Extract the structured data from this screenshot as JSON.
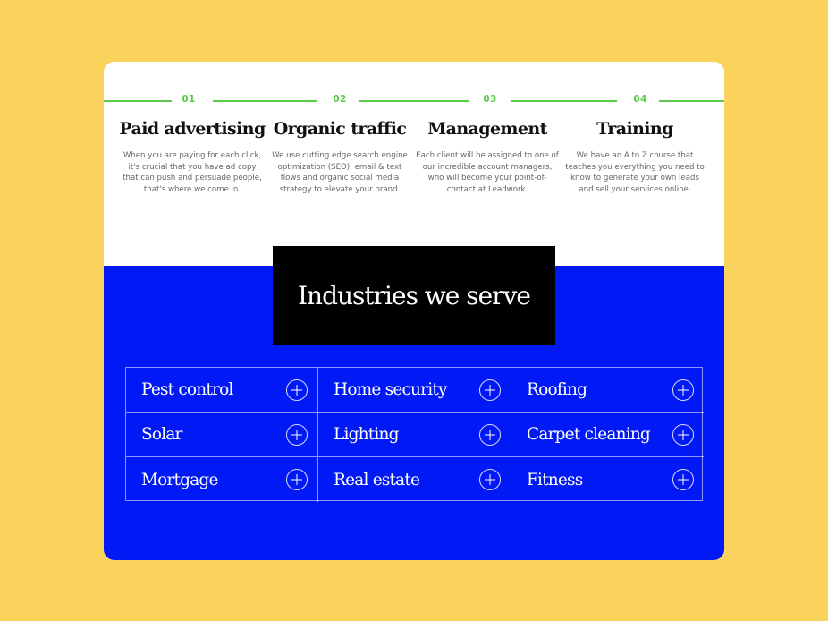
{
  "colors": {
    "background": "#f9d35b",
    "accent_green": "#5bc94a",
    "brand_blue": "#0019f5",
    "heading_box": "#000000"
  },
  "steps": [
    {
      "number": "01",
      "title": "Paid advertising",
      "description": "When you are paying for each click, it's crucial that you have ad copy that can push and persuade people, that's where we come in."
    },
    {
      "number": "02",
      "title": "Organic traffic",
      "description": "We use cutting edge search engine optimization (SEO), email & text flows and organic social media strategy to elevate your brand."
    },
    {
      "number": "03",
      "title": "Management",
      "description": "Each client will be assigned to one of our incredible account managers, who will become your point-of-contact at Leadwork."
    },
    {
      "number": "04",
      "title": "Training",
      "description": "We have an A to Z course that teaches you everything you need to know to generate your own leads and sell your services online."
    }
  ],
  "industries": {
    "heading": "Industries we serve",
    "expand_icon": "plus-circle-icon",
    "items": [
      {
        "label": "Pest control"
      },
      {
        "label": "Home security"
      },
      {
        "label": "Roofing"
      },
      {
        "label": "Solar"
      },
      {
        "label": "Lighting"
      },
      {
        "label": "Carpet cleaning"
      },
      {
        "label": "Mortgage"
      },
      {
        "label": "Real estate"
      },
      {
        "label": "Fitness"
      }
    ]
  }
}
